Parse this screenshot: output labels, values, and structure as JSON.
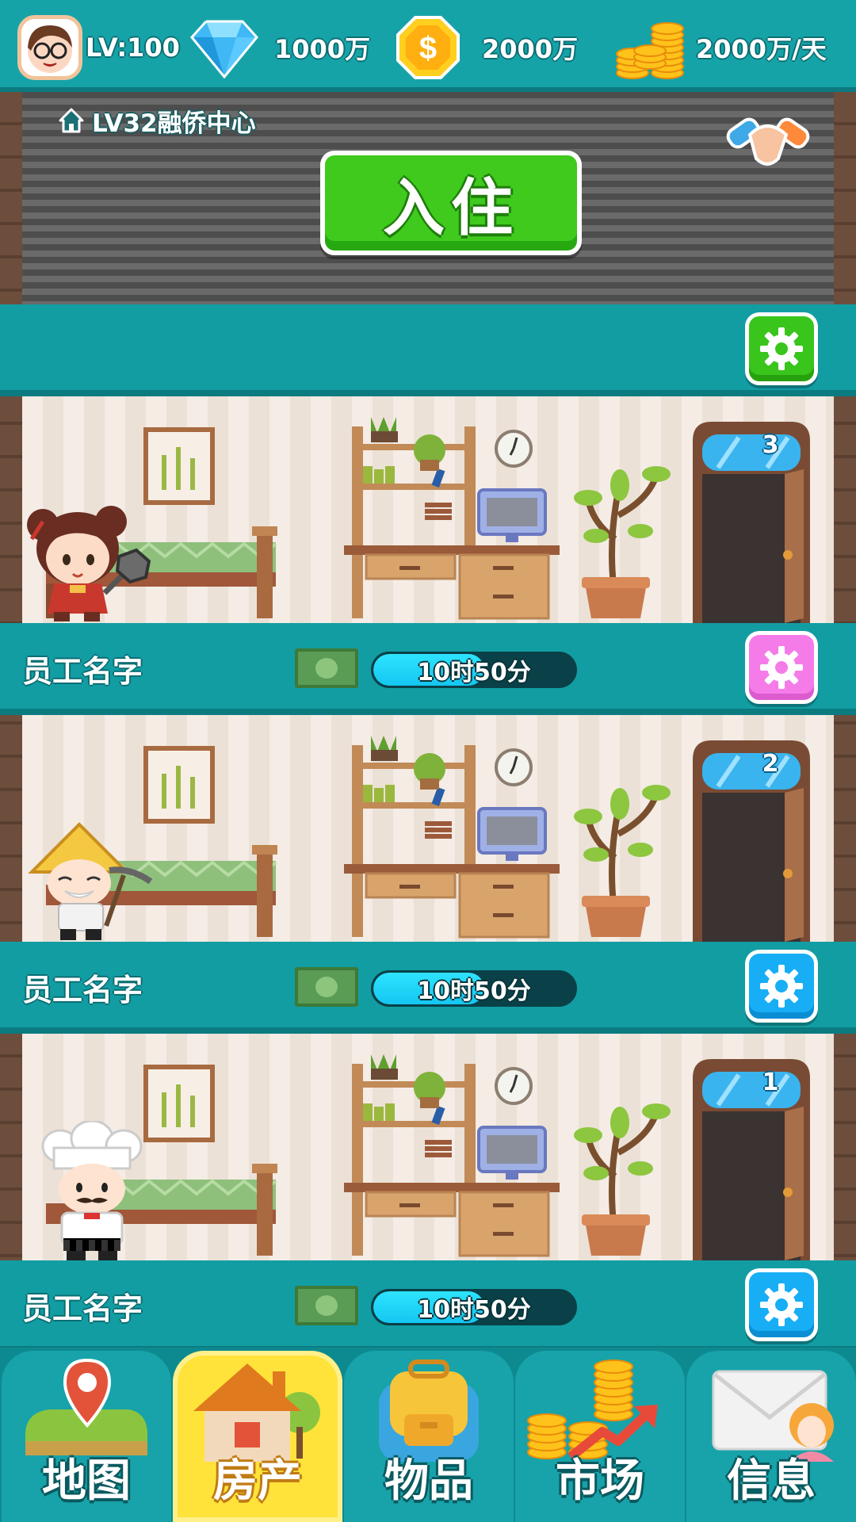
{
  "top_bar": {
    "level": "LV:100",
    "diamonds": "1000万",
    "coins": "2000万",
    "income": "2000万/天"
  },
  "building": {
    "name": "LV32融侨中心",
    "checkin_label": "入住"
  },
  "rooms": [
    {
      "door_number": "3",
      "worker_name": "员工名字",
      "timer": "10时50分",
      "progress": 0.55,
      "gear_color": "#f57ce8",
      "character": "girl-with-pan"
    },
    {
      "door_number": "2",
      "worker_name": "员工名字",
      "timer": "10时50分",
      "progress": 0.55,
      "gear_color": "#17aef5",
      "character": "old-man-with-pickaxe"
    },
    {
      "door_number": "1",
      "worker_name": "员工名字",
      "timer": "10时50分",
      "progress": 0.55,
      "gear_color": "#17aef5",
      "character": "chef"
    }
  ],
  "nav": [
    {
      "label": "地图",
      "icon": "map-icon"
    },
    {
      "label": "房产",
      "icon": "house-icon",
      "active": true
    },
    {
      "label": "物品",
      "icon": "backpack-icon"
    },
    {
      "label": "市场",
      "icon": "market-icon"
    },
    {
      "label": "信息",
      "icon": "mail-icon"
    }
  ],
  "colors": {
    "teal": "#16a3a8",
    "green_button": "#3fca1d",
    "active_tab": "#ffe33a"
  }
}
